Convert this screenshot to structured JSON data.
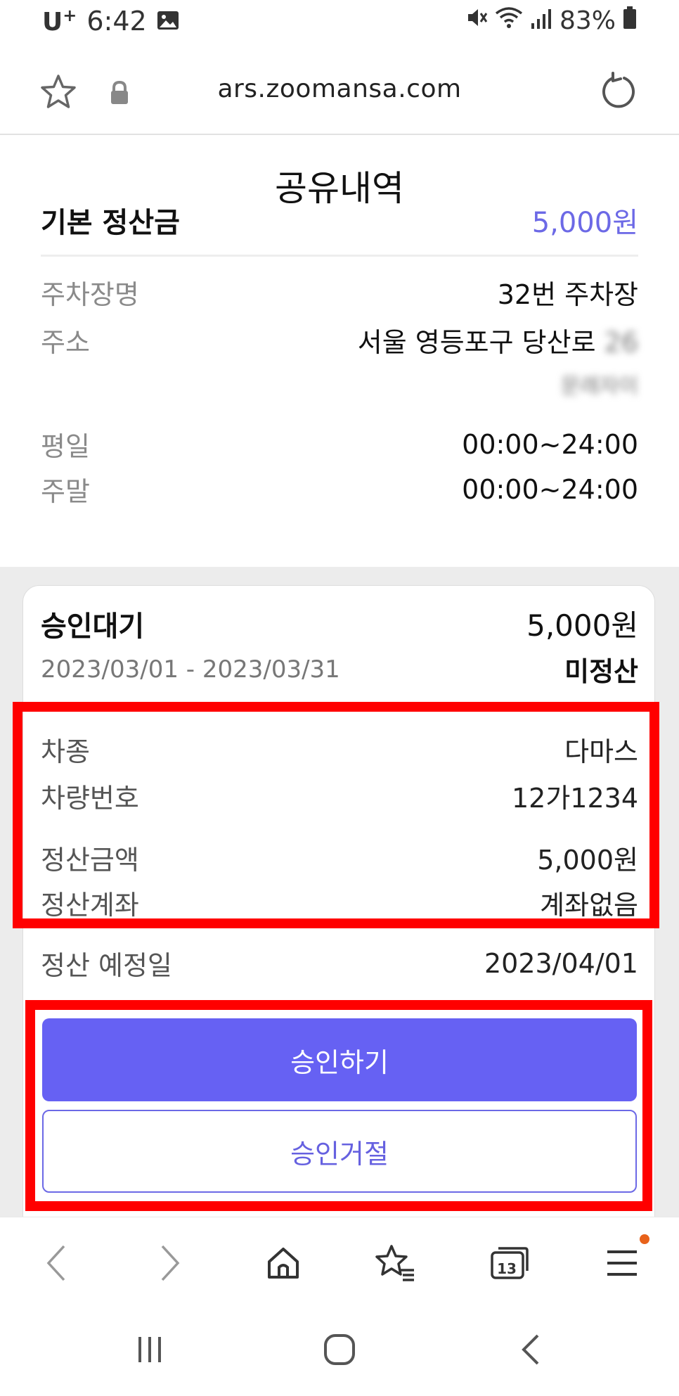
{
  "status_bar": {
    "carrier": "U",
    "carrier_sup": "+",
    "time": "6:42",
    "battery": "83%"
  },
  "browser": {
    "url": "ars.zoomansa.com",
    "tab_count": "13"
  },
  "page": {
    "title": "공유내역",
    "basic_fee_label": "기본 정산금",
    "basic_fee_value": "5,000원",
    "info": {
      "lot_name_label": "주차장명",
      "lot_name_value": "32번 주차장",
      "address_label": "주소",
      "address_value": "서울 영등포구 당산로",
      "address_number_blurred": "26",
      "address_detail_blurred": "문래자이",
      "weekday_label": "평일",
      "weekday_value": "00:00~24:00",
      "weekend_label": "주말",
      "weekend_value": "00:00~24:00"
    }
  },
  "card": {
    "status": "승인대기",
    "amount": "5,000원",
    "period": "2023/03/01 - 2023/03/31",
    "settlement_state": "미정산",
    "details": {
      "car_model_label": "차종",
      "car_model_value": "다마스",
      "plate_label": "차량번호",
      "plate_value": "12가1234",
      "settle_amount_label": "정산금액",
      "settle_amount_value": "5,000원",
      "settle_account_label": "정산계좌",
      "settle_account_value": "계좌없음",
      "settle_date_label": "정산 예정일",
      "settle_date_value": "2023/04/01"
    },
    "approve_label": "승인하기",
    "reject_label": "승인거절"
  },
  "colors": {
    "accent": "#6661f3",
    "highlight_box": "#ff0000",
    "notification_dot": "#e8621a"
  }
}
